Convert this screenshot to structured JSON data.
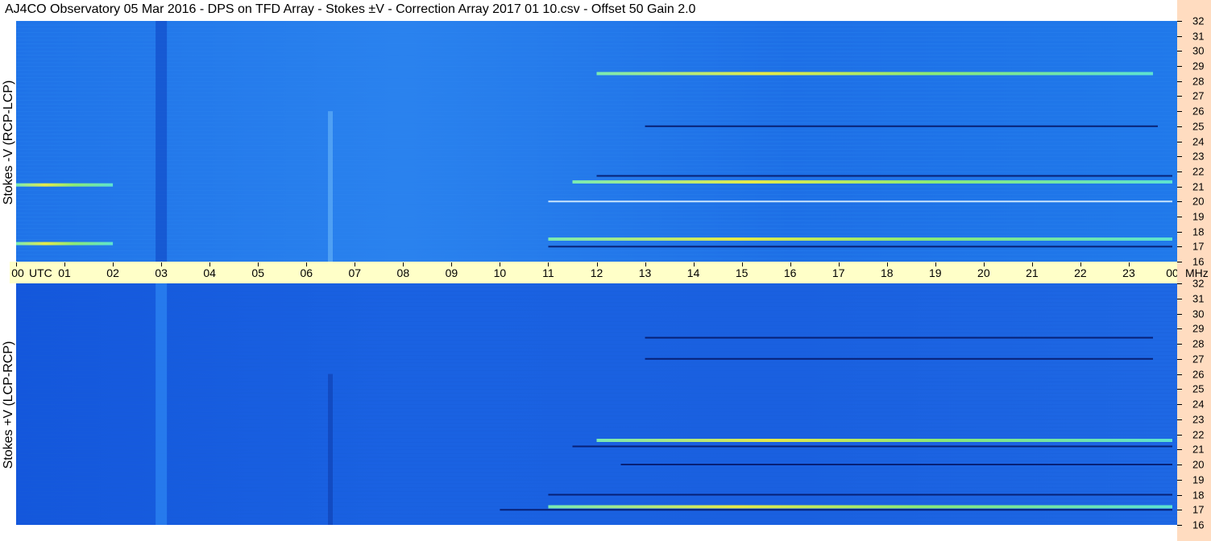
{
  "title": "AJ4CO Observatory  05 Mar 2016  -  DPS on TFD Array  -  Stokes ±V  -  Correction Array 2017 01 10.csv  -  Offset 50  Gain 2.0",
  "x_unit": "UTC",
  "y_unit": "MHz",
  "colors": {
    "background": "#1666e6",
    "axis_band": "#ffffc8",
    "right_strip": "#ffdcc0",
    "low": "#0a2fa0",
    "high_green": "#90f070",
    "high_yellow": "#f0f030"
  },
  "chart_data": [
    {
      "type": "heatmap",
      "panel": "top",
      "ylabel": "Stokes -V (RCP-LCP)",
      "xlabel": "UTC",
      "x_ticks": [
        "00",
        "01",
        "02",
        "03",
        "04",
        "05",
        "06",
        "07",
        "08",
        "09",
        "10",
        "11",
        "12",
        "13",
        "14",
        "15",
        "16",
        "17",
        "18",
        "19",
        "20",
        "21",
        "22",
        "23",
        "00"
      ],
      "y_ticks": [
        16,
        17,
        18,
        19,
        20,
        21,
        22,
        23,
        24,
        25,
        26,
        27,
        28,
        29,
        30,
        31,
        32
      ],
      "xlim": [
        0,
        24
      ],
      "ylim": [
        16,
        32
      ],
      "bands": [
        {
          "freq": 28.5,
          "start": 12.0,
          "end": 23.5,
          "level": "high"
        },
        {
          "freq": 21.7,
          "start": 12.0,
          "end": 23.9,
          "level": "low"
        },
        {
          "freq": 21.3,
          "start": 11.5,
          "end": 23.9,
          "level": "high"
        },
        {
          "freq": 21.1,
          "start": 0.0,
          "end": 2.0,
          "level": "high"
        },
        {
          "freq": 25.0,
          "start": 13.0,
          "end": 23.6,
          "level": "low"
        },
        {
          "freq": 20.0,
          "start": 11.0,
          "end": 23.9,
          "level": "mixed"
        },
        {
          "freq": 17.5,
          "start": 11.0,
          "end": 23.9,
          "level": "high"
        },
        {
          "freq": 17.2,
          "start": 0.0,
          "end": 2.0,
          "level": "high"
        },
        {
          "freq": 17.0,
          "start": 11.0,
          "end": 23.9,
          "level": "low"
        }
      ],
      "dark_columns": [
        3.0
      ],
      "bursts": [
        6.5
      ]
    },
    {
      "type": "heatmap",
      "panel": "bottom",
      "ylabel": "Stokes +V (LCP-RCP)",
      "xlabel": "UTC",
      "x_ticks": [
        "00",
        "01",
        "02",
        "03",
        "04",
        "05",
        "06",
        "07",
        "08",
        "09",
        "10",
        "11",
        "12",
        "13",
        "14",
        "15",
        "16",
        "17",
        "18",
        "19",
        "20",
        "21",
        "22",
        "23",
        "00"
      ],
      "y_ticks": [
        16,
        17,
        18,
        19,
        20,
        21,
        22,
        23,
        24,
        25,
        26,
        27,
        28,
        29,
        30,
        31,
        32
      ],
      "xlim": [
        0,
        24
      ],
      "ylim": [
        16,
        32
      ],
      "bands": [
        {
          "freq": 28.4,
          "start": 13.0,
          "end": 23.5,
          "level": "low"
        },
        {
          "freq": 27.0,
          "start": 13.0,
          "end": 23.5,
          "level": "low"
        },
        {
          "freq": 21.6,
          "start": 12.0,
          "end": 23.9,
          "level": "high"
        },
        {
          "freq": 21.2,
          "start": 11.5,
          "end": 23.9,
          "level": "low"
        },
        {
          "freq": 20.0,
          "start": 12.5,
          "end": 23.9,
          "level": "low"
        },
        {
          "freq": 18.0,
          "start": 11.0,
          "end": 23.9,
          "level": "low"
        },
        {
          "freq": 17.0,
          "start": 10.0,
          "end": 23.9,
          "level": "low"
        },
        {
          "freq": 17.2,
          "start": 11.0,
          "end": 23.9,
          "level": "high"
        }
      ],
      "bright_columns": [
        3.0
      ],
      "bursts": [
        6.5
      ]
    }
  ]
}
